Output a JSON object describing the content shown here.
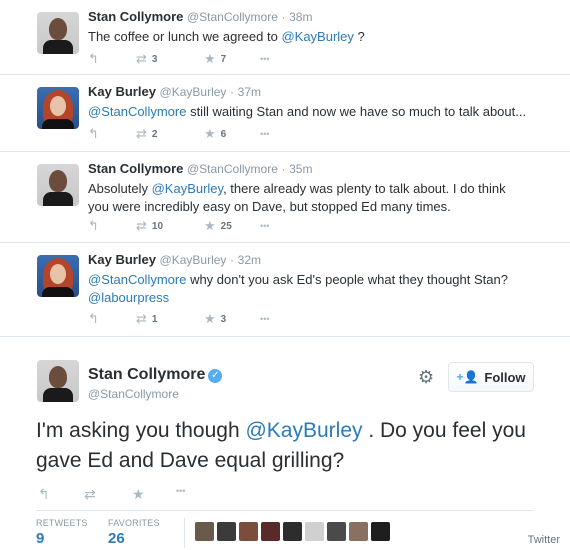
{
  "tweets": [
    {
      "name": "Stan Collymore",
      "handle": "@StanCollymore",
      "dot": "·",
      "time": "38m",
      "text_parts": [
        "The coffee or lunch we agreed to ",
        "@KayBurley",
        " ?"
      ],
      "retweets": "3",
      "favorites": "7"
    },
    {
      "name": "Kay Burley",
      "handle": "@KayBurley",
      "dot": "·",
      "time": "37m",
      "text_parts": [
        "@StanCollymore",
        " still waiting Stan and now we have so much to talk about..."
      ],
      "retweets": "2",
      "favorites": "6"
    },
    {
      "name": "Stan Collymore",
      "handle": "@StanCollymore",
      "dot": "·",
      "time": "35m",
      "text_parts": [
        "Absolutely ",
        "@KayBurley",
        ", there already was plenty to talk about. I do think you were incredibly easy on Dave, but stopped Ed many times."
      ],
      "retweets": "10",
      "favorites": "25"
    },
    {
      "name": "Kay Burley",
      "handle": "@KayBurley",
      "dot": "·",
      "time": "32m",
      "text_parts": [
        "@StanCollymore",
        " why don't you ask Ed's people what they thought Stan? ",
        "@labourpress"
      ],
      "retweets": "1",
      "favorites": "3"
    }
  ],
  "icons": {
    "reply": "↰",
    "retweet": "⇄",
    "favorite": "★",
    "more": "•••",
    "verified": "✓",
    "gear": "⚙",
    "follow": "+👤"
  },
  "main_tweet": {
    "name": "Stan Collymore",
    "handle": "@StanCollymore",
    "follow_label": "Follow",
    "text_parts": [
      "I'm asking you though ",
      "@KayBurley",
      " . Do you feel you gave Ed and Dave equal grilling?"
    ],
    "retweets_label": "RETWEETS",
    "retweets_count": "9",
    "favorites_label": "FAVORITES",
    "favorites_count": "26"
  },
  "favoriter_colors": [
    "#6a5a4a",
    "#3b3b3b",
    "#7a4e3a",
    "#5a2a2a",
    "#2d2d2d",
    "#d0d0d0",
    "#4a4a4a",
    "#8a7060",
    "#1e1e1e"
  ],
  "credit": "Twitter",
  "colors": {
    "link": "#2b7bb9",
    "verified": "#55acee"
  }
}
